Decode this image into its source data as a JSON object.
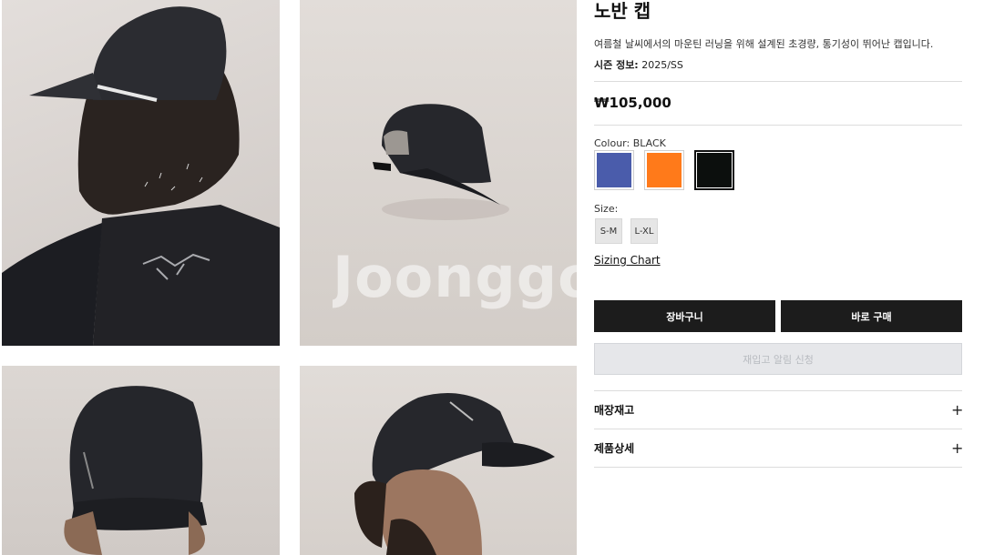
{
  "watermark": "Joonggonara",
  "product": {
    "title": "노반 캡",
    "description": "여름철 날씨에서의 마운틴 러닝을 위해 설계된 초경량, 통기성이 뛰어난 캡입니다.",
    "season_label": "시즌 정보:",
    "season_value": "2025/SS",
    "price": "₩105,000"
  },
  "colour": {
    "label": "Colour: BLACK",
    "options": [
      {
        "name": "blue",
        "hex": "#4a5cab"
      },
      {
        "name": "orange",
        "hex": "#ff7a1a"
      },
      {
        "name": "black",
        "hex": "#0c0f0d"
      }
    ],
    "selected": "black"
  },
  "size": {
    "label": "Size:",
    "options": [
      "S-M",
      "L-XL"
    ]
  },
  "sizing_chart": "Sizing Chart",
  "actions": {
    "cart": "장바구니",
    "buy_now": "바로 구매",
    "restock": "재입고 알림 신청"
  },
  "accordion": [
    {
      "label": "매장재고",
      "icon": "plus-icon"
    },
    {
      "label": "제품상세",
      "icon": "plus-icon"
    }
  ],
  "colors": {
    "button_dark": "#1c1c1c",
    "disabled_bg": "#e6e7ea"
  }
}
